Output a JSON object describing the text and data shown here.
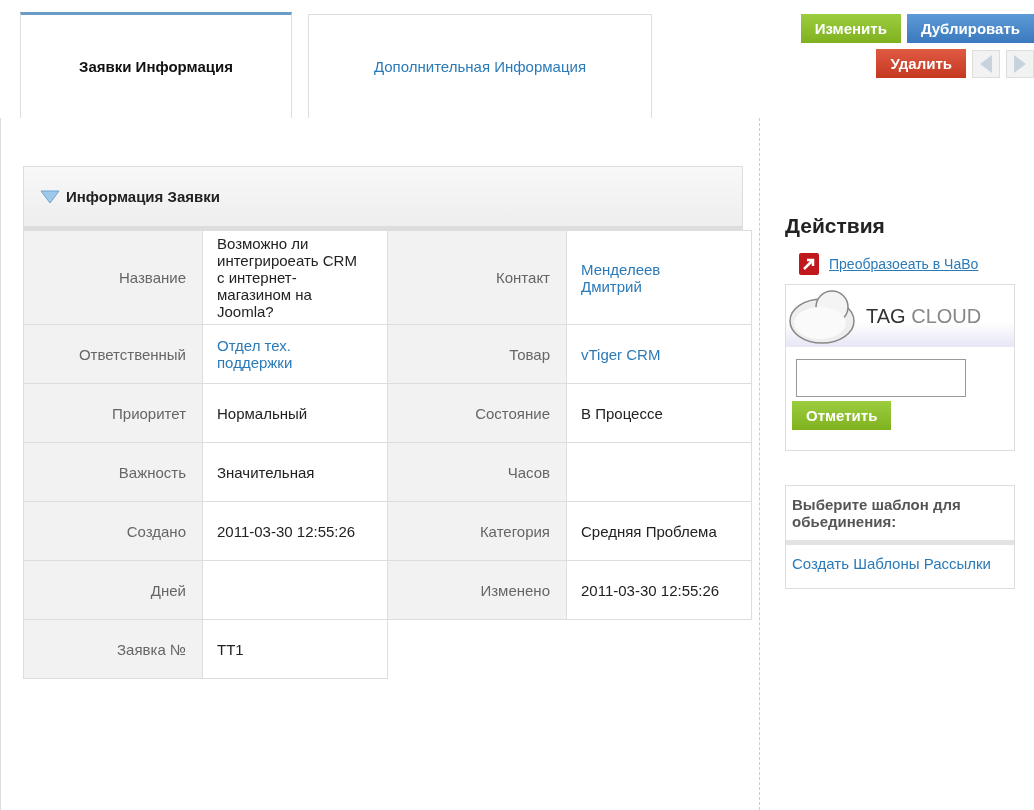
{
  "tabs": [
    {
      "label": "Заявки Информация",
      "selected": true
    },
    {
      "label": "Дополнительная Информация",
      "selected": false
    }
  ],
  "buttons": [
    {
      "label": "Изменить",
      "kind": "edit"
    },
    {
      "label": "Дублировать",
      "kind": "duplicate"
    },
    {
      "label": "Удалить",
      "kind": "delete"
    }
  ],
  "block": {
    "title": "Информация Заявки",
    "expanded": true,
    "rows": [
      [
        {
          "label": "Название",
          "value": "Возможно ли интегрироеать CRM с интернет-магазином на Joomla?"
        },
        {
          "label": "Контакт",
          "value": "Менделеев Дмитрий",
          "link": true
        }
      ],
      [
        {
          "label": "Ответственный",
          "value": "Отдел тех. поддержки",
          "link": true
        },
        {
          "label": "Товар",
          "value": "vTiger CRM",
          "link": true
        }
      ],
      [
        {
          "label": "Приоритет",
          "value": "Нормальный"
        },
        {
          "label": "Состояние",
          "value": "В Процессе"
        }
      ],
      [
        {
          "label": "Важность",
          "value": "Значительная"
        },
        {
          "label": "Часов"
        }
      ],
      [
        {
          "label": "Создано",
          "value": "2011-03-30 12:55:26"
        },
        {
          "label": "Категория",
          "value": "Средняя Проблема"
        }
      ],
      [
        {
          "label": "Дней"
        },
        {
          "label": "Изменено",
          "value": "2011-03-30 12:55:26"
        }
      ],
      [
        {
          "label": "Заявка №",
          "value": "TT1"
        }
      ]
    ]
  },
  "sidebar": {
    "title": "Действия",
    "action": "Преобразоеать в ЧаВо",
    "tag_cloud": {
      "title_1": "TAG",
      "title_2": "CLOUD",
      "button": "Отметить"
    },
    "template": {
      "title": "Выберите шаблон для обьединения:",
      "link": "Создать Шаблоны Рассылки"
    }
  }
}
